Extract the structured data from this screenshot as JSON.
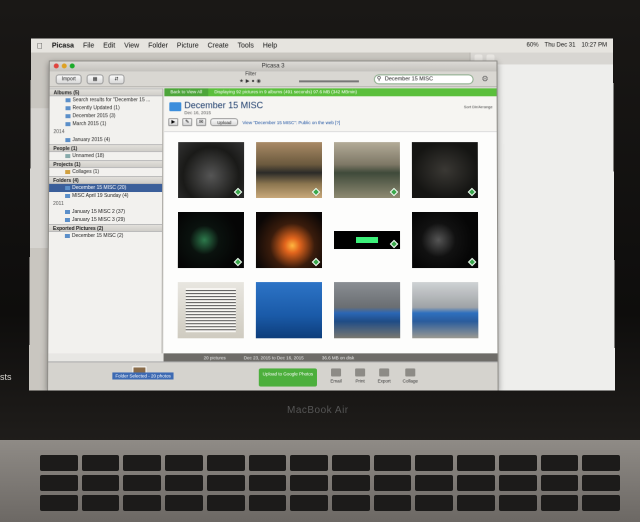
{
  "menubar": {
    "apple": "",
    "app": "Picasa",
    "items": [
      "File",
      "Edit",
      "View",
      "Folder",
      "Picture",
      "Create",
      "Tools",
      "Help"
    ],
    "right": [
      "60%",
      "Thu Dec 31",
      "10:27 PM"
    ]
  },
  "window": {
    "title": "Picasa 3",
    "import_label": "Import",
    "filter_label": "Filter",
    "search_value": "December 15 MISC"
  },
  "banner": {
    "back_label": "Back to View All",
    "info": "Displaying 92 pictures in 9 albums (491 seconds) 97.6 MB (342 MBmin)"
  },
  "sidebar": {
    "albums_header": "Albums (5)",
    "albums": [
      "Search results for \"December 15 ...",
      "Recently Updated (1)",
      "December 2015 (3)",
      "March 2015 (1)"
    ],
    "year_2014": "2014",
    "album_2014": "January 2015 (4)",
    "people_header": "People (1)",
    "people_item": "Unnamed (18)",
    "projects_header": "Projects (1)",
    "projects_item": "Collages (1)",
    "folders_header": "Folders (4)",
    "folder_selected": "December 15 MISC (20)",
    "folder_2": "MISC April 19 Sunday (4)",
    "year_2011": "2011",
    "folder_3": "January 15 MISC 2 (37)",
    "folder_4": "January 15 MISC 3 (29)",
    "exported_header": "Exported Pictures (2)",
    "exported_item": "December 15 MISC (2)"
  },
  "album_header": {
    "title": "December 15 MISC",
    "date": "Dec 16, 2015",
    "upload_label": "Upload",
    "view_link": "View \"December 15 MISC\": Public on the web [?]",
    "sort_label": "Sort Dir/Arrange"
  },
  "statusbar": {
    "count": "20 pictures",
    "range": "Dec 23, 2015 to Dec 16, 2015",
    "size": "36.6 MB on disk"
  },
  "bottom": {
    "tray_label": "Folder Selected - 20 photos",
    "upload_google": "Upload to Google Photos",
    "buttons": [
      "Email",
      "Print",
      "Export",
      "Collage"
    ]
  },
  "photos": [
    "jeep-dashboard-night",
    "jeep-forest",
    "jeep-field",
    "jeep-interior",
    "green-glow",
    "campfire",
    "green-display",
    "gauge-cluster",
    "document",
    "blue-car-hood",
    "blue-hatchback",
    "blue-hatchback-2"
  ],
  "caption": "sts",
  "brand": "MacBook Air"
}
